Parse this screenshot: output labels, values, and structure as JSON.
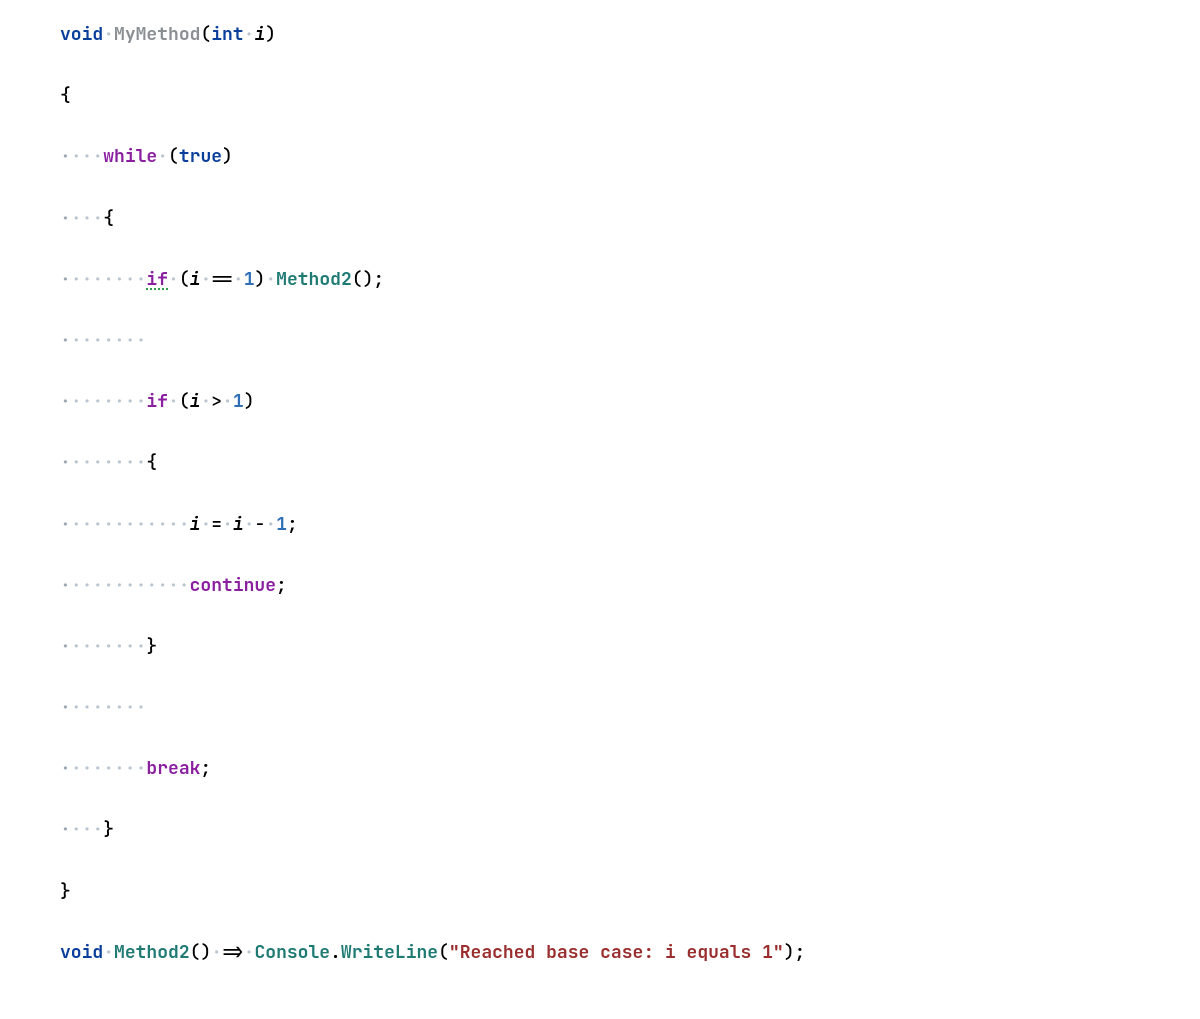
{
  "code": {
    "line1": {
      "void": "void",
      "method": "MyMethod",
      "lparen": "(",
      "int": "int",
      "param": "i",
      "rparen": ")"
    },
    "line2": {
      "brace": "{"
    },
    "line3": {
      "while": "while",
      "lparen": "(",
      "true": "true",
      "rparen": ")"
    },
    "line4": {
      "brace": "{"
    },
    "line5": {
      "if": "if",
      "lparen": "(",
      "i": "i",
      "eq": "==",
      "one": "1",
      "rparen": ")",
      "call": "Method2",
      "call_lparen": "(",
      "call_rparen": ")",
      "semi": ";"
    },
    "line7": {
      "if": "if",
      "lparen": "(",
      "i": "i",
      "gt": ">",
      "one": "1",
      "rparen": ")"
    },
    "line8": {
      "brace": "{"
    },
    "line9": {
      "i1": "i",
      "assign": "=",
      "i2": "i",
      "minus": "-",
      "one": "1",
      "semi": ";"
    },
    "line10": {
      "continue": "continue",
      "semi": ";"
    },
    "line11": {
      "brace": "}"
    },
    "line13": {
      "break": "break",
      "semi": ";"
    },
    "line14": {
      "brace": "}"
    },
    "line15": {
      "brace": "}"
    },
    "line16": {
      "void": "void",
      "method": "Method2",
      "lparen": "(",
      "rparen": ")",
      "arrow": "=>",
      "console": "Console",
      "dot": ".",
      "writeline": "WriteLine",
      "wl_lparen": "(",
      "string": "\"Reached base case: i equals 1\"",
      "wl_rparen": ")",
      "semi": ";"
    }
  },
  "whitespace": {
    "dot": "·",
    "indent4": "····",
    "indent8": "········",
    "indent12": "············"
  }
}
